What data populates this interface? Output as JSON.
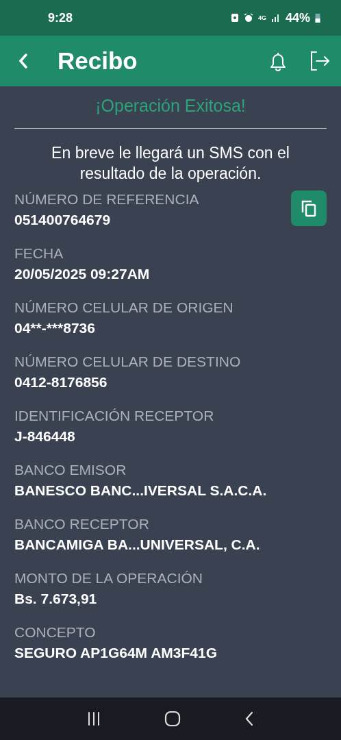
{
  "status_bar": {
    "time": "9:28",
    "battery": "44%",
    "network": "4G"
  },
  "header": {
    "title": "Recibo"
  },
  "success_title": "¡Operación Exitosa!",
  "message": "En breve le llegará un SMS con el resultado de la operación.",
  "fields": [
    {
      "label": "NÚMERO DE REFERENCIA",
      "value": "051400764679",
      "copyable": true
    },
    {
      "label": "FECHA",
      "value": "20/05/2025 09:27AM",
      "copyable": false
    },
    {
      "label": "NÚMERO CELULAR DE ORIGEN",
      "value": "04**-***8736",
      "copyable": false
    },
    {
      "label": "NÚMERO CELULAR DE DESTINO",
      "value": "0412-8176856",
      "copyable": false
    },
    {
      "label": "IDENTIFICACIÓN RECEPTOR",
      "value": "J-846448",
      "copyable": false
    },
    {
      "label": "BANCO EMISOR",
      "value": "BANESCO BANC...IVERSAL S.A.C.A.",
      "copyable": false
    },
    {
      "label": "BANCO RECEPTOR",
      "value": "BANCAMIGA BA...UNIVERSAL, C.A.",
      "copyable": false
    },
    {
      "label": "MONTO DE LA OPERACIÓN",
      "value": "Bs. 7.673,91",
      "copyable": false
    },
    {
      "label": "CONCEPTO",
      "value": "SEGURO AP1G64M AM3F41G",
      "copyable": false
    }
  ]
}
